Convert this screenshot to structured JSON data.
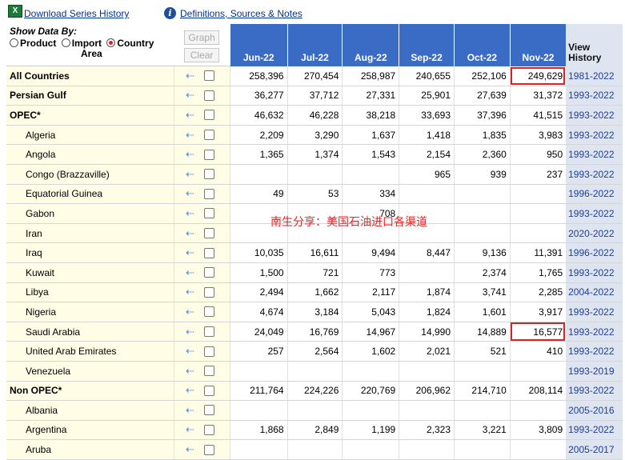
{
  "toolbar": {
    "download_label": "Download Series History",
    "definitions_label": "Definitions, Sources & Notes"
  },
  "show_by": {
    "title": "Show Data By:",
    "options": [
      "Product",
      "Import Area",
      "Country"
    ],
    "selected": "Country"
  },
  "buttons": {
    "graph": "Graph",
    "clear": "Clear"
  },
  "columns": [
    "Jun-22",
    "Jul-22",
    "Aug-22",
    "Sep-22",
    "Oct-22",
    "Nov-22"
  ],
  "view_history_label": "View History",
  "rows": [
    {
      "name": "All Countries",
      "bold": true,
      "sub": false,
      "values": [
        "258,396",
        "270,454",
        "258,987",
        "240,655",
        "252,106",
        "249,629"
      ],
      "history": "1981-2022"
    },
    {
      "name": "Persian Gulf",
      "bold": true,
      "sub": false,
      "values": [
        "36,277",
        "37,712",
        "27,331",
        "25,901",
        "27,639",
        "31,372"
      ],
      "history": "1993-2022"
    },
    {
      "name": "OPEC*",
      "bold": true,
      "sub": false,
      "values": [
        "46,632",
        "46,228",
        "38,218",
        "33,693",
        "37,396",
        "41,515"
      ],
      "history": "1993-2022"
    },
    {
      "name": "Algeria",
      "bold": false,
      "sub": true,
      "values": [
        "2,209",
        "3,290",
        "1,637",
        "1,418",
        "1,835",
        "3,983"
      ],
      "history": "1993-2022"
    },
    {
      "name": "Angola",
      "bold": false,
      "sub": true,
      "values": [
        "1,365",
        "1,374",
        "1,543",
        "2,154",
        "2,360",
        "950"
      ],
      "history": "1993-2022"
    },
    {
      "name": "Congo (Brazzaville)",
      "bold": false,
      "sub": true,
      "values": [
        "",
        "",
        "",
        "965",
        "939",
        "237"
      ],
      "history": "1993-2022"
    },
    {
      "name": "Equatorial Guinea",
      "bold": false,
      "sub": true,
      "values": [
        "49",
        "53",
        "334",
        "",
        "",
        ""
      ],
      "history": "1996-2022"
    },
    {
      "name": "Gabon",
      "bold": false,
      "sub": true,
      "values": [
        "",
        "",
        "708",
        "",
        "",
        ""
      ],
      "history": "1993-2022"
    },
    {
      "name": "Iran",
      "bold": false,
      "sub": true,
      "values": [
        "",
        "",
        "",
        "",
        "",
        ""
      ],
      "history": "2020-2022"
    },
    {
      "name": "Iraq",
      "bold": false,
      "sub": true,
      "values": [
        "10,035",
        "16,611",
        "9,494",
        "8,447",
        "9,136",
        "11,391"
      ],
      "history": "1996-2022"
    },
    {
      "name": "Kuwait",
      "bold": false,
      "sub": true,
      "values": [
        "1,500",
        "721",
        "773",
        "",
        "2,374",
        "1,765"
      ],
      "history": "1993-2022"
    },
    {
      "name": "Libya",
      "bold": false,
      "sub": true,
      "values": [
        "2,494",
        "1,662",
        "2,117",
        "1,874",
        "3,741",
        "2,285"
      ],
      "history": "2004-2022"
    },
    {
      "name": "Nigeria",
      "bold": false,
      "sub": true,
      "values": [
        "4,674",
        "3,184",
        "5,043",
        "1,824",
        "1,601",
        "3,917"
      ],
      "history": "1993-2022"
    },
    {
      "name": "Saudi Arabia",
      "bold": false,
      "sub": true,
      "values": [
        "24,049",
        "16,769",
        "14,967",
        "14,990",
        "14,889",
        "16,577"
      ],
      "history": "1993-2022"
    },
    {
      "name": "United Arab Emirates",
      "bold": false,
      "sub": true,
      "values": [
        "257",
        "2,564",
        "1,602",
        "2,021",
        "521",
        "410"
      ],
      "history": "1993-2022"
    },
    {
      "name": "Venezuela",
      "bold": false,
      "sub": true,
      "values": [
        "",
        "",
        "",
        "",
        "",
        ""
      ],
      "history": "1993-2019"
    },
    {
      "name": "Non OPEC*",
      "bold": true,
      "sub": false,
      "values": [
        "211,764",
        "224,226",
        "220,769",
        "206,962",
        "214,710",
        "208,114"
      ],
      "history": "1993-2022"
    },
    {
      "name": "Albania",
      "bold": false,
      "sub": true,
      "values": [
        "",
        "",
        "",
        "",
        "",
        ""
      ],
      "history": "2005-2016"
    },
    {
      "name": "Argentina",
      "bold": false,
      "sub": true,
      "values": [
        "1,868",
        "2,849",
        "1,199",
        "2,323",
        "3,221",
        "3,809"
      ],
      "history": "1993-2022"
    },
    {
      "name": "Aruba",
      "bold": false,
      "sub": true,
      "values": [
        "",
        "",
        "",
        "",
        "",
        ""
      ],
      "history": "2005-2017"
    }
  ],
  "highlighted_cells": [
    {
      "row": "All Countries",
      "col": "Nov-22"
    },
    {
      "row": "Saudi Arabia",
      "col": "Nov-22"
    }
  ],
  "watermark": "南生分享：美国石油进口各渠道",
  "colors": {
    "header_bg": "#3a6cc6",
    "label_bg": "#fffde6",
    "history_bg": "#dfe5f0",
    "highlight": "#e02020"
  }
}
